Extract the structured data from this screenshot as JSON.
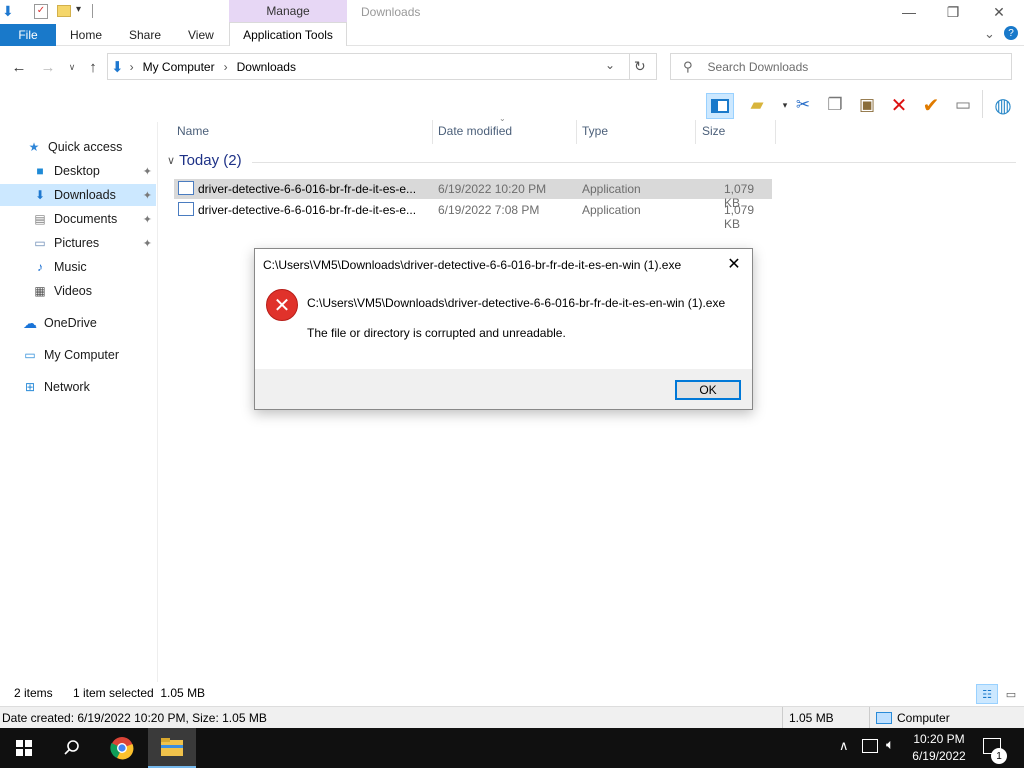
{
  "titlebar": {
    "manage_label": "Manage",
    "title": "Downloads",
    "minimize": "—",
    "maximize": "❐",
    "close": "✕"
  },
  "ribbon": {
    "file": "File",
    "home": "Home",
    "share": "Share",
    "view": "View",
    "app_tools": "Application Tools",
    "expand_icon": "⌄",
    "help_icon": "?"
  },
  "address": {
    "breadcrumb": [
      "My Computer",
      "Downloads"
    ],
    "separator": "›",
    "search_placeholder": "Search Downloads"
  },
  "nav": {
    "items": [
      {
        "label": "Quick access",
        "icon": "★",
        "color": "#2f86d8"
      },
      {
        "label": "Desktop",
        "icon": "■",
        "color": "#1e8ad6",
        "pinned": true
      },
      {
        "label": "Downloads",
        "icon": "⬇",
        "color": "#1e78d0",
        "pinned": true,
        "selected": true
      },
      {
        "label": "Documents",
        "icon": "▤",
        "color": "#7d7d7d",
        "pinned": true
      },
      {
        "label": "Pictures",
        "icon": "▭",
        "color": "#6b8bb5",
        "pinned": true
      },
      {
        "label": "Music",
        "icon": "♪",
        "color": "#1b6fd1"
      },
      {
        "label": "Videos",
        "icon": "▦",
        "color": "#555"
      },
      {
        "label": "OneDrive",
        "icon": "☁",
        "color": "#1a74d8"
      },
      {
        "label": "My Computer",
        "icon": "▭",
        "color": "#2a8bd8"
      },
      {
        "label": "Network",
        "icon": "⊞",
        "color": "#2a8bd8"
      }
    ],
    "pin_icon": "📌"
  },
  "columns": {
    "name": "Name",
    "date": "Date modified",
    "type": "Type",
    "size": "Size"
  },
  "group": {
    "label": "Today (2)",
    "chevron": "∨"
  },
  "files": [
    {
      "name": "driver-detective-6-6-016-br-fr-de-it-es-e...",
      "date": "6/19/2022 10:20 PM",
      "type": "Application",
      "size": "1,079 KB",
      "selected": true
    },
    {
      "name": "driver-detective-6-6-016-br-fr-de-it-es-e...",
      "date": "6/19/2022 7:08 PM",
      "type": "Application",
      "size": "1,079 KB",
      "selected": false
    }
  ],
  "dialog": {
    "title": "C:\\Users\\VM5\\Downloads\\driver-detective-6-6-016-br-fr-de-it-es-en-win (1).exe",
    "path": "C:\\Users\\VM5\\Downloads\\driver-detective-6-6-016-br-fr-de-it-es-en-win (1).exe",
    "message": "The file or directory is corrupted and unreadable.",
    "ok": "OK",
    "close_icon": "✕",
    "error_icon": "✕"
  },
  "status": {
    "items": "2 items",
    "selected": "1 item selected  1.05 MB",
    "details": "Date created: 6/19/2022 10:20 PM, Size: 1.05 MB",
    "size": "1.05 MB",
    "location": "Computer"
  },
  "taskbar": {
    "time": "10:20 PM",
    "date": "6/19/2022",
    "notification_count": "1"
  }
}
